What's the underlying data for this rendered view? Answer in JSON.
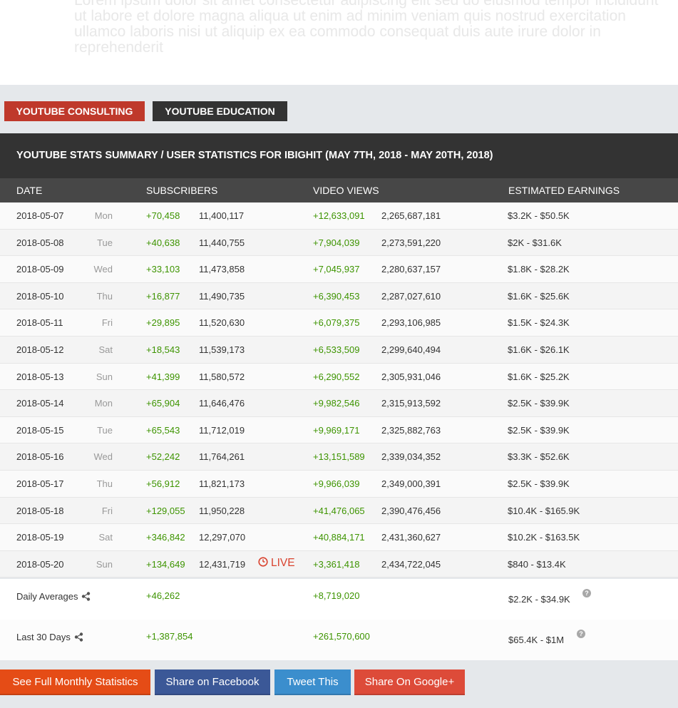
{
  "faded_text": "Lorem ipsum dolor sit amet consectetur adipiscing elit sed do eiusmod tempor incididunt ut labore et dolore magna aliqua ut enim ad minim veniam quis nostrud exercitation ullamco laboris nisi ut aliquip ex ea commodo consequat duis aute irure dolor in reprehenderit",
  "tabs": {
    "consulting": "YOUTUBE CONSULTING",
    "education": "YOUTUBE EDUCATION"
  },
  "summary_title": "YOUTUBE STATS SUMMARY / USER STATISTICS FOR IBIGHIT (MAY 7TH, 2018 - MAY 20TH, 2018)",
  "columns": {
    "date": "DATE",
    "subscribers": "SUBSCRIBERS",
    "views": "VIDEO VIEWS",
    "earnings": "ESTIMATED EARNINGS"
  },
  "rows": [
    {
      "date": "2018-05-07",
      "day": "Mon",
      "subs_gain": "+70,458",
      "subs": "11,400,117",
      "views_gain": "+12,633,091",
      "views": "2,265,687,181",
      "earnings": "$3.2K  -  $50.5K"
    },
    {
      "date": "2018-05-08",
      "day": "Tue",
      "subs_gain": "+40,638",
      "subs": "11,440,755",
      "views_gain": "+7,904,039",
      "views": "2,273,591,220",
      "earnings": "$2K  -  $31.6K"
    },
    {
      "date": "2018-05-09",
      "day": "Wed",
      "subs_gain": "+33,103",
      "subs": "11,473,858",
      "views_gain": "+7,045,937",
      "views": "2,280,637,157",
      "earnings": "$1.8K  -  $28.2K"
    },
    {
      "date": "2018-05-10",
      "day": "Thu",
      "subs_gain": "+16,877",
      "subs": "11,490,735",
      "views_gain": "+6,390,453",
      "views": "2,287,027,610",
      "earnings": "$1.6K  -  $25.6K"
    },
    {
      "date": "2018-05-11",
      "day": "Fri",
      "subs_gain": "+29,895",
      "subs": "11,520,630",
      "views_gain": "+6,079,375",
      "views": "2,293,106,985",
      "earnings": "$1.5K  -  $24.3K"
    },
    {
      "date": "2018-05-12",
      "day": "Sat",
      "subs_gain": "+18,543",
      "subs": "11,539,173",
      "views_gain": "+6,533,509",
      "views": "2,299,640,494",
      "earnings": "$1.6K  -  $26.1K"
    },
    {
      "date": "2018-05-13",
      "day": "Sun",
      "subs_gain": "+41,399",
      "subs": "11,580,572",
      "views_gain": "+6,290,552",
      "views": "2,305,931,046",
      "earnings": "$1.6K  -  $25.2K"
    },
    {
      "date": "2018-05-14",
      "day": "Mon",
      "subs_gain": "+65,904",
      "subs": "11,646,476",
      "views_gain": "+9,982,546",
      "views": "2,315,913,592",
      "earnings": "$2.5K  -  $39.9K"
    },
    {
      "date": "2018-05-15",
      "day": "Tue",
      "subs_gain": "+65,543",
      "subs": "11,712,019",
      "views_gain": "+9,969,171",
      "views": "2,325,882,763",
      "earnings": "$2.5K  -  $39.9K"
    },
    {
      "date": "2018-05-16",
      "day": "Wed",
      "subs_gain": "+52,242",
      "subs": "11,764,261",
      "views_gain": "+13,151,589",
      "views": "2,339,034,352",
      "earnings": "$3.3K  -  $52.6K"
    },
    {
      "date": "2018-05-17",
      "day": "Thu",
      "subs_gain": "+56,912",
      "subs": "11,821,173",
      "views_gain": "+9,966,039",
      "views": "2,349,000,391",
      "earnings": "$2.5K  -  $39.9K"
    },
    {
      "date": "2018-05-18",
      "day": "Fri",
      "subs_gain": "+129,055",
      "subs": "11,950,228",
      "views_gain": "+41,476,065",
      "views": "2,390,476,456",
      "earnings": "$10.4K  -  $165.9K"
    },
    {
      "date": "2018-05-19",
      "day": "Sat",
      "subs_gain": "+346,842",
      "subs": "12,297,070",
      "views_gain": "+40,884,171",
      "views": "2,431,360,627",
      "earnings": "$10.2K  -  $163.5K"
    },
    {
      "date": "2018-05-20",
      "day": "Sun",
      "subs_gain": "+134,649",
      "subs": "12,431,719",
      "views_gain": "+3,361,418",
      "views": "2,434,722,045",
      "earnings": "$840  -  $13.4K",
      "live": "LIVE"
    }
  ],
  "daily_averages": {
    "label": "Daily Averages",
    "subs_gain": "+46,262",
    "views_gain": "+8,719,020",
    "earnings": "$2.2K  -  $34.9K"
  },
  "last_30_days": {
    "label": "Last 30 Days",
    "subs_gain": "+1,387,854",
    "views_gain": "+261,570,600",
    "earnings": "$65.4K  -  $1M"
  },
  "help_glyph": "?",
  "buttons": {
    "monthly": "See Full Monthly Statistics",
    "facebook": "Share on Facebook",
    "twitter": "Tweet This",
    "google": "Share On Google+"
  },
  "colors": {
    "consulting_tab": "#bf392b",
    "dark_header": "#333333",
    "gain_green": "#3d9400",
    "live_red": "#d9432f",
    "monthly_button": "#e54c16",
    "facebook_button": "#3b5897",
    "twitter_button": "#3b8ecd",
    "google_button": "#dd4b39"
  },
  "icons": {
    "share": "share-icon",
    "help": "help-icon",
    "live": "clock-icon"
  }
}
